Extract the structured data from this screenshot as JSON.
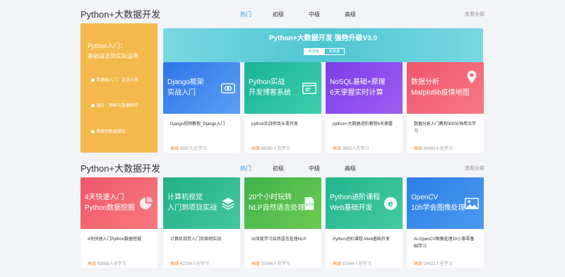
{
  "section1": {
    "title": "Python+大数据开发",
    "tabs": [
      "热门",
      "初级",
      "中级",
      "高级"
    ],
    "more": "查看全部",
    "promo": {
      "title": "Python入门：",
      "subtitle": "基础语法到实际运用",
      "items": [
        "零基础入门：语法与界",
        "进阶：网络与数据爬存",
        "界面到数据储存"
      ]
    },
    "banner": {
      "title": "Python+大数据开发 强势升级V3.0",
      "pills": [
        "新突破",
        "新未来"
      ]
    },
    "cards": [
      {
        "img_text": "Django框架\n实战入门",
        "name": "Django视频教程_Django入门",
        "level": "高级",
        "meta": "·9037人在学习",
        "colors": [
          "#2f74e8",
          "#5aa0f5"
        ],
        "icon": "link-icon"
      },
      {
        "img_text": "Python实战\n开发博客系统",
        "name": "python实战项目从零开发",
        "level": "高级",
        "meta": "·88380人在学习",
        "colors": [
          "#1ab394",
          "#3ccfae"
        ],
        "icon": "browser-icon"
      },
      {
        "img_text": "NoSQL基础+原理\n6天掌握实时计算",
        "name": "python+大数据进阶教程6天掌握",
        "level": "高级",
        "meta": "·3802人在学习",
        "colors": [
          "#7b3ee6",
          "#a05df2"
        ],
        "icon": "none"
      },
      {
        "img_text": "数据分析\nMatplotlib疫情地图",
        "name": "数据分析入门教程300分钟用法学习",
        "level": "高级",
        "meta": "·54093人在学习",
        "colors": [
          "#f0546a",
          "#f67a85"
        ],
        "icon": "map-pin-icon"
      }
    ]
  },
  "section2": {
    "title": "Python+大数据开发",
    "tabs": [
      "热门",
      "初级",
      "中级",
      "高级"
    ],
    "more": "查看全部",
    "cards": [
      {
        "img_text": "4天快速入门\nPython数据挖掘",
        "name": "4天快速入门Python数据挖掘",
        "level": "高级",
        "meta": "·83556人在学习",
        "colors": [
          "#f0566a",
          "#f77a7e"
        ],
        "icon": "pie-chart-icon"
      },
      {
        "img_text": "计算机视觉\n入门到项目实战",
        "name": "计算机视觉入门及案例实战",
        "level": "高级",
        "meta": "·42234人在学习",
        "colors": [
          "#20b088",
          "#45c79e"
        ],
        "icon": "layers-icon"
      },
      {
        "img_text": "20个小时玩转\nNLP自然语言处理",
        "name": "AI深度学习自然语言处理NLP",
        "level": "高级",
        "meta": "·33846人在学习",
        "colors": [
          "#3fb24a",
          "#6ccb52"
        ],
        "icon": "code-file-icon"
      },
      {
        "img_text": "Python进阶课程\nWeb基础开发",
        "name": "Python进阶课程-Web基础开发",
        "level": "高级",
        "meta": "·81544人在学习",
        "colors": [
          "#21b58e",
          "#47c9a1"
        ],
        "icon": "browser-e-icon"
      },
      {
        "img_text": "OpenCV\n10h学会图像处理",
        "name": "AI-OpenCV图像处理10小事零基础学习",
        "level": "高级",
        "meta": "·34922人在学习",
        "colors": [
          "#2b7ee6",
          "#4c9af0"
        ],
        "icon": "image-icon"
      }
    ]
  }
}
